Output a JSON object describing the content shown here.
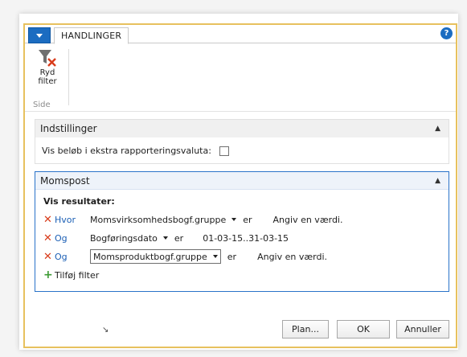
{
  "ribbon": {
    "tab_label": "HANDLINGER",
    "button": {
      "label_line1": "Ryd",
      "label_line2": "filter",
      "icon": "clear-filter-icon"
    },
    "group_label": "Side"
  },
  "settings": {
    "title": "Indstillinger",
    "option_label": "Vis beløb i ekstra rapporteringsvaluta:",
    "option_checked": false
  },
  "vat_entry": {
    "title": "Momspost",
    "show_results_label": "Vis resultater:",
    "filters": [
      {
        "operator": "Hvor",
        "field": "Momsvirksomhedsbogf.gruppe",
        "comparator": "er",
        "value": "Angiv en værdi."
      },
      {
        "operator": "Og",
        "field": "Bogføringsdato",
        "comparator": "er",
        "value": "01-03-15..31-03-15"
      },
      {
        "operator": "Og",
        "field": "Momsproduktbogf.gruppe",
        "comparator": "er",
        "value": "Angiv en værdi."
      }
    ],
    "add_filter_label": "Tilføj filter"
  },
  "buttons": {
    "plan": "Plan...",
    "ok": "OK",
    "cancel": "Annuller"
  },
  "colors": {
    "accent": "#1b6cc1",
    "frame": "#e7c15e",
    "remove": "#d83b1a",
    "add": "#3d9b35"
  }
}
